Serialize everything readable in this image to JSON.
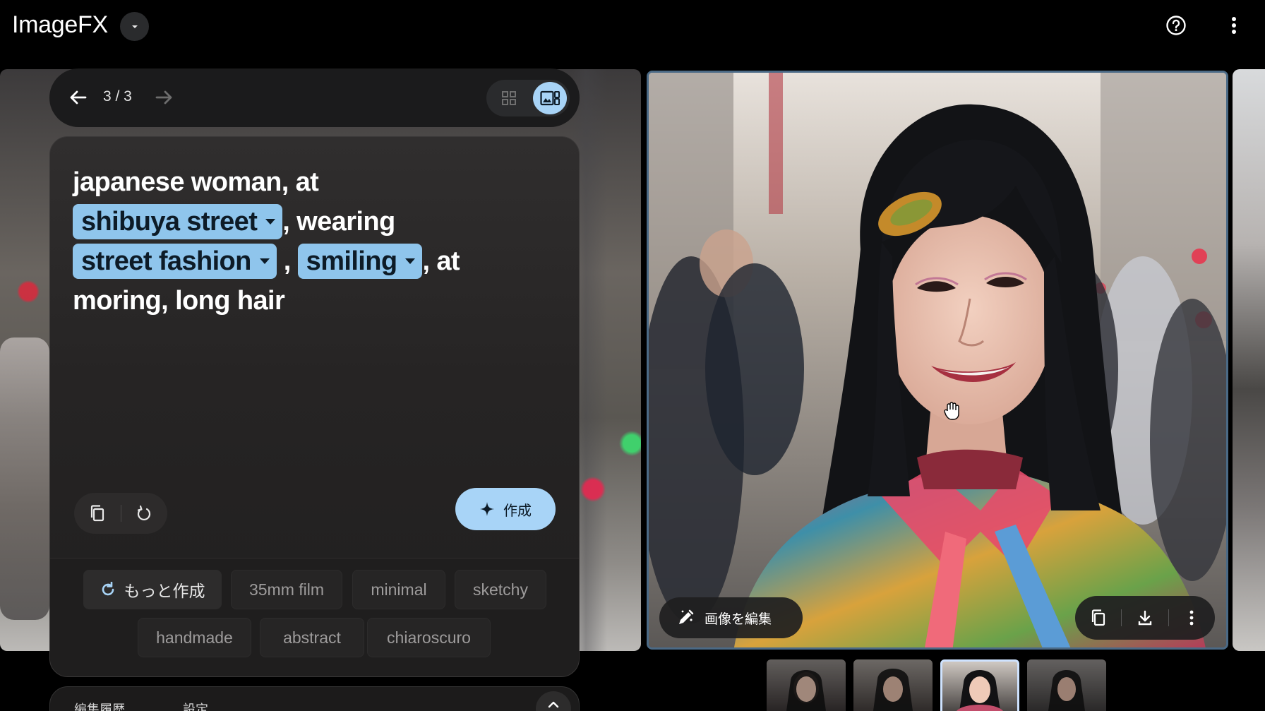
{
  "header": {
    "app_title": "ImageFX",
    "title_dropdown_icon": "chevron-down-icon",
    "help_icon": "help-circle-icon",
    "more_icon": "more-vert-icon"
  },
  "navigator": {
    "counter": "3 / 3",
    "back_icon": "arrow-left-icon",
    "forward_icon": "arrow-right-icon",
    "grid_view_icon": "grid-view-icon",
    "single_view_icon": "single-view-icon"
  },
  "prompt": {
    "line1_text": "japanese woman, at",
    "chip1": "shibuya street",
    "after_chip1": ", wearing",
    "chip2": "street fashion",
    "between_chips": " , ",
    "chip3": "smiling",
    "after_chip3": ", at",
    "line4_text": "moring, long hair"
  },
  "prompt_tools": {
    "copy_icon": "copy-icon",
    "reset_icon": "reset-icon",
    "create_label": "作成",
    "create_icon": "sparkle-icon"
  },
  "suggestions": {
    "more_label": "もっと作成",
    "more_icon": "refresh-icon",
    "items": [
      "35mm film",
      "minimal",
      "sketchy",
      "handmade",
      "abstract",
      "chiaroscuro"
    ]
  },
  "bottom_panel": {
    "tab1": "編集履歴",
    "tab2": "設定",
    "toggle_icon": "chevron-up-icon"
  },
  "image_actions": {
    "edit_label": "画像を編集",
    "edit_icon": "pencil-icon",
    "copy_icon": "copy-icon",
    "download_icon": "download-icon",
    "more_icon": "more-vert-icon"
  },
  "thumbnails": {
    "count": 4,
    "active_index": 2
  },
  "colors": {
    "accent": "#a8d4f7",
    "chip": "#8fc5ec",
    "panel": "#262424",
    "image_border": "#4b6a86"
  }
}
